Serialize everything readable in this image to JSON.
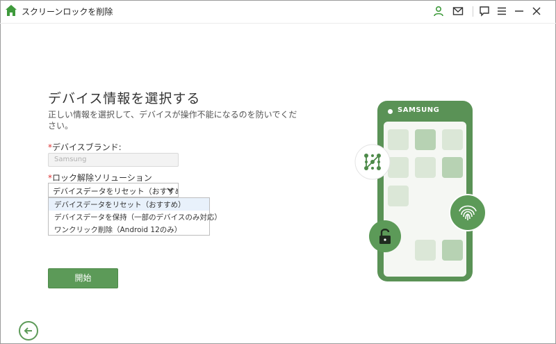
{
  "app": {
    "title": "スクリーンロックを削除"
  },
  "header_icons": [
    "home-icon",
    "user-icon",
    "mail-icon",
    "feedback-icon",
    "menu-icon",
    "minimize-icon",
    "close-icon"
  ],
  "form": {
    "title": "デバイス情報を選択する",
    "subtitle": "正しい情報を選択して、デバイスが操作不能になるのを防いでください。",
    "required_mark": "*",
    "brand_label": "デバイスブランド:",
    "brand_value": "Samsung",
    "solution_label": "ロック解除ソリューション",
    "solution_selected": "デバイスデータをリセット（おすすめ）",
    "solution_options": [
      "デバイスデータをリセット（おすすめ）",
      "デバイスデータを保持（一部のデバイスのみ対応）",
      "ワンクリック削除（Android 12のみ）"
    ],
    "start_label": "開始"
  },
  "illustration": {
    "phone_brand": "SAMSUNG",
    "accent": "#5c9a58"
  }
}
